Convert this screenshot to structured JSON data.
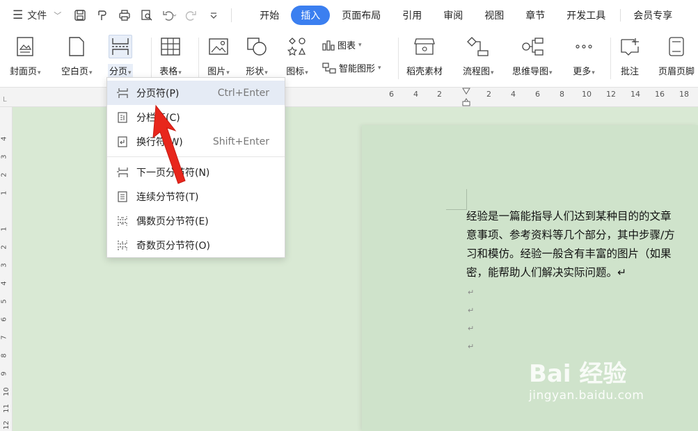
{
  "file_menu": {
    "label": "文件"
  },
  "tabs": [
    {
      "label": "开始",
      "active": false
    },
    {
      "label": "插入",
      "active": true
    },
    {
      "label": "页面布局",
      "active": false
    },
    {
      "label": "引用",
      "active": false
    },
    {
      "label": "审阅",
      "active": false
    },
    {
      "label": "视图",
      "active": false
    },
    {
      "label": "章节",
      "active": false
    },
    {
      "label": "开发工具",
      "active": false
    },
    {
      "label": "会员专享",
      "active": false
    }
  ],
  "ribbon": {
    "cover": "封面页",
    "blank": "空白页",
    "page_break": "分页",
    "table": "表格",
    "picture": "图片",
    "shape": "形状",
    "icon": "图标",
    "chart": "图表",
    "smart": "智能图形",
    "material": "稻壳素材",
    "flow": "流程图",
    "mind": "思维导图",
    "more": "更多",
    "comment": "批注",
    "header_footer": "页眉页脚"
  },
  "ruler_ticks": [
    "6",
    "4",
    "2",
    "2",
    "4",
    "6",
    "8",
    "10",
    "12",
    "14",
    "16",
    "18"
  ],
  "vruler_ticks": [
    "4",
    "3",
    "2",
    "1",
    "1",
    "2",
    "3",
    "4",
    "5",
    "6",
    "7",
    "8",
    "9",
    "10",
    "11",
    "12"
  ],
  "menu": {
    "items": [
      {
        "label": "分页符(P)",
        "shortcut": "Ctrl+Enter",
        "icon": "page-break-icon"
      },
      {
        "label": "分栏符(C)",
        "shortcut": "",
        "icon": "column-break-icon"
      },
      {
        "label": "换行符(W)",
        "shortcut": "Shift+Enter",
        "icon": "line-break-icon"
      },
      {
        "label": "下一页分节符(N)",
        "shortcut": "",
        "icon": "next-page-section-icon"
      },
      {
        "label": "连续分节符(T)",
        "shortcut": "",
        "icon": "continuous-section-icon"
      },
      {
        "label": "偶数页分节符(E)",
        "shortcut": "",
        "icon": "even-page-section-icon"
      },
      {
        "label": "奇数页分节符(O)",
        "shortcut": "",
        "icon": "odd-page-section-icon"
      }
    ]
  },
  "document": {
    "lines": [
      "经验是一篇能指导人们达到某种目的的文章",
      "意事项、参考资料等几个部分，其中步骤/方",
      "习和模仿。经验一般含有丰富的图片（如果",
      "密，能帮助人们解决实际问题。↵"
    ],
    "para_mark": "↵"
  },
  "watermark": {
    "logo": "Bai 经验",
    "url": "jingyan.baidu.com"
  },
  "colors": {
    "accent": "#3b7ff0",
    "canvas": "#d9e9d4",
    "arrow": "#e8261c"
  }
}
